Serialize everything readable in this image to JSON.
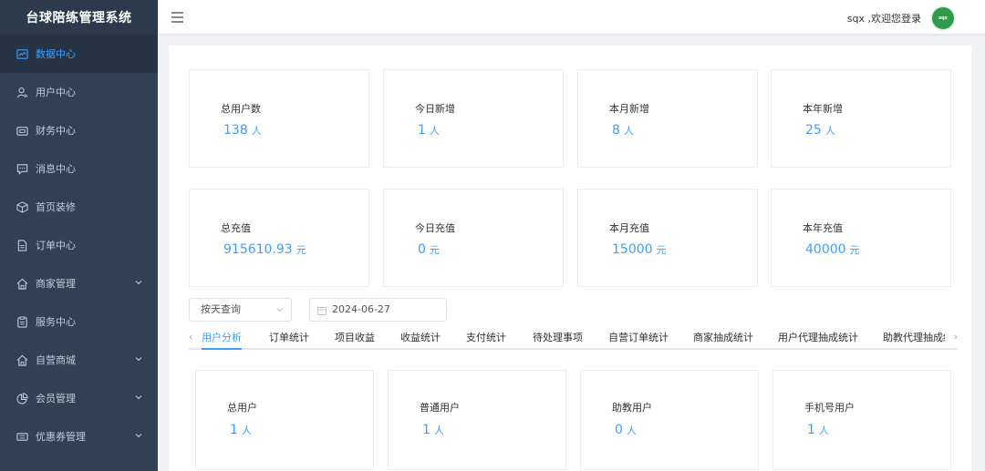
{
  "app": {
    "title": "台球陪练管理系统"
  },
  "sidebar": {
    "items": [
      {
        "label": "数据中心",
        "active": true,
        "icon": "dashboard-icon"
      },
      {
        "label": "用户中心",
        "icon": "user-icon"
      },
      {
        "label": "财务中心",
        "icon": "wallet-icon"
      },
      {
        "label": "消息中心",
        "icon": "message-icon"
      },
      {
        "label": "首页装修",
        "icon": "cube-icon"
      },
      {
        "label": "订单中心",
        "icon": "document-icon"
      },
      {
        "label": "商家管理",
        "icon": "home-icon",
        "expandable": true
      },
      {
        "label": "服务中心",
        "icon": "clipboard-icon"
      },
      {
        "label": "自营商城",
        "icon": "home-icon",
        "expandable": true
      },
      {
        "label": "会员管理",
        "icon": "pie-chart-icon",
        "expandable": true
      },
      {
        "label": "优惠券管理",
        "icon": "coupon-icon",
        "expandable": true
      }
    ]
  },
  "header": {
    "welcome": "sqx ,欢迎您登录",
    "avatar_text": "sqx"
  },
  "stats_row1": [
    {
      "label": "总用户数",
      "value": "138",
      "unit": "人"
    },
    {
      "label": "今日新增",
      "value": "1",
      "unit": "人"
    },
    {
      "label": "本月新增",
      "value": "8",
      "unit": "人"
    },
    {
      "label": "本年新增",
      "value": "25",
      "unit": "人"
    }
  ],
  "stats_row2": [
    {
      "label": "总充值",
      "value": "915610.93",
      "unit": "元"
    },
    {
      "label": "今日充值",
      "value": "0",
      "unit": "元"
    },
    {
      "label": "本月充值",
      "value": "15000",
      "unit": "元"
    },
    {
      "label": "本年充值",
      "value": "40000",
      "unit": "元"
    }
  ],
  "filters": {
    "query_mode": "按天查询",
    "date": "2024-06-27"
  },
  "tabs": [
    {
      "label": "用户分析",
      "active": true
    },
    {
      "label": "订单统计"
    },
    {
      "label": "项目收益"
    },
    {
      "label": "收益统计"
    },
    {
      "label": "支付统计"
    },
    {
      "label": "待处理事项"
    },
    {
      "label": "自营订单统计"
    },
    {
      "label": "商家抽成统计"
    },
    {
      "label": "用户代理抽成统计"
    },
    {
      "label": "助教代理抽成统计"
    }
  ],
  "user_stats": [
    {
      "label": "总用户",
      "value": "1",
      "unit": "人"
    },
    {
      "label": "普通用户",
      "value": "1",
      "unit": "人"
    },
    {
      "label": "助教用户",
      "value": "0",
      "unit": "人"
    },
    {
      "label": "手机号用户",
      "value": "1",
      "unit": "人"
    }
  ],
  "colors": {
    "sidebar_bg": "#304156",
    "accent": "#409eff"
  }
}
